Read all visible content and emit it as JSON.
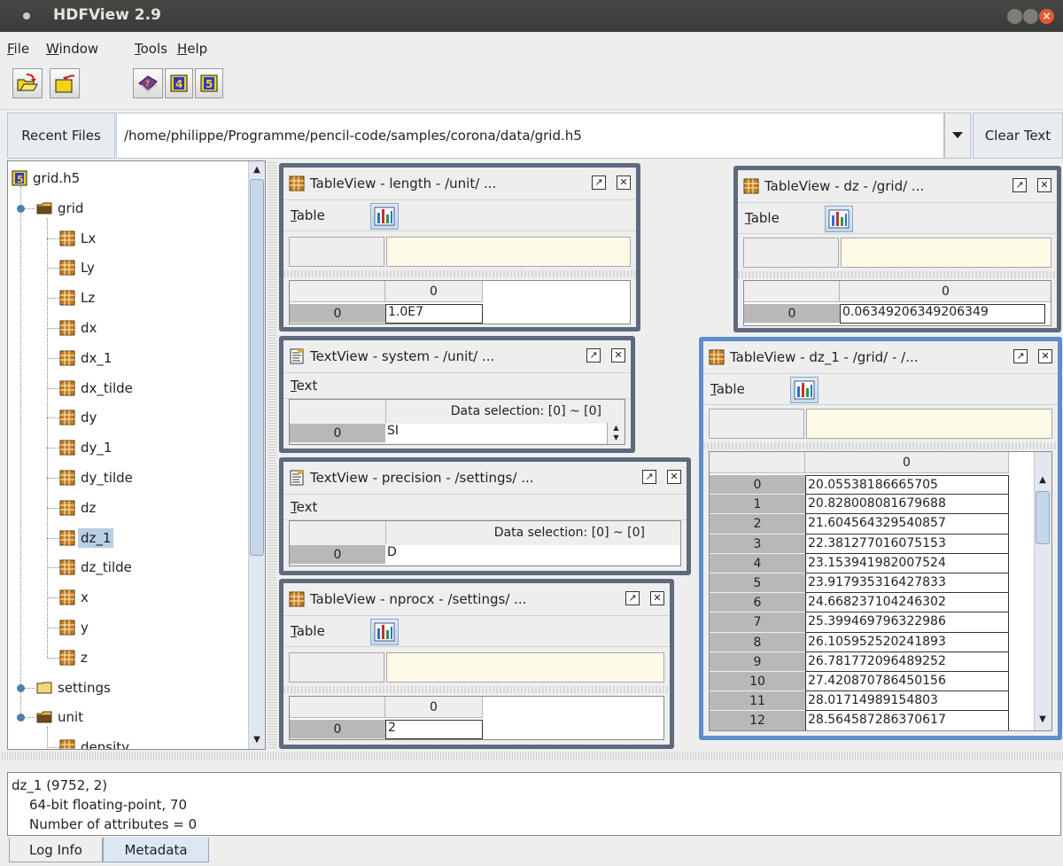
{
  "window": {
    "title": "HDFView 2.9"
  },
  "menu": [
    {
      "label": "File",
      "u": "F",
      "rest": "ile"
    },
    {
      "label": "Window",
      "u": "W",
      "rest": "indow"
    },
    {
      "label": "Tools",
      "u": "T",
      "rest": "ools"
    },
    {
      "label": "Help",
      "u": "H",
      "rest": "elp"
    }
  ],
  "toolbar": {
    "open_icon": "open-file-icon",
    "close_icon": "close-file-icon",
    "help_icon": "help-book-icon",
    "hdf4_icon": "hdf4-library-icon",
    "hdf5_icon": "hdf5-library-icon"
  },
  "recent": {
    "button_label": "Recent Files",
    "path": "/home/philippe/Programme/pencil-code/samples/corona/data/grid.h5",
    "clear_label": "Clear Text"
  },
  "tree": {
    "root": "grid.h5",
    "items": [
      {
        "label": "grid",
        "kind": "group-open",
        "level": 1
      },
      {
        "label": "Lx",
        "kind": "dataset",
        "level": 2
      },
      {
        "label": "Ly",
        "kind": "dataset",
        "level": 2
      },
      {
        "label": "Lz",
        "kind": "dataset",
        "level": 2
      },
      {
        "label": "dx",
        "kind": "dataset",
        "level": 2
      },
      {
        "label": "dx_1",
        "kind": "dataset",
        "level": 2
      },
      {
        "label": "dx_tilde",
        "kind": "dataset",
        "level": 2
      },
      {
        "label": "dy",
        "kind": "dataset",
        "level": 2
      },
      {
        "label": "dy_1",
        "kind": "dataset",
        "level": 2
      },
      {
        "label": "dy_tilde",
        "kind": "dataset",
        "level": 2
      },
      {
        "label": "dz",
        "kind": "dataset",
        "level": 2
      },
      {
        "label": "dz_1",
        "kind": "dataset",
        "level": 2,
        "selected": true
      },
      {
        "label": "dz_tilde",
        "kind": "dataset",
        "level": 2
      },
      {
        "label": "x",
        "kind": "dataset",
        "level": 2
      },
      {
        "label": "y",
        "kind": "dataset",
        "level": 2
      },
      {
        "label": "z",
        "kind": "dataset",
        "level": 2
      },
      {
        "label": "settings",
        "kind": "group-closed",
        "level": 1
      },
      {
        "label": "unit",
        "kind": "group-open",
        "level": 1
      },
      {
        "label": "density",
        "kind": "dataset",
        "level": 2
      }
    ]
  },
  "frames": {
    "length": {
      "title": "TableView  -  length  -  /unit/  ...",
      "menu": "Table",
      "menu_u": "T",
      "menu_rest": "able",
      "col_header": "0",
      "row_header": "0",
      "value": "1.0E7"
    },
    "system": {
      "title": "TextView  -  system  -  /unit/  ...",
      "menu": "Text",
      "menu_u": "T",
      "menu_rest": "ext",
      "selection": "Data selection:   [0] ~ [0]",
      "row_header": "0",
      "value": "SI"
    },
    "precision": {
      "title": "TextView  -  precision  -  /settings/  ...",
      "menu": "Text",
      "menu_u": "T",
      "menu_rest": "ext",
      "selection": "Data selection:   [0] ~ [0]",
      "row_header": "0",
      "value": "D"
    },
    "nprocx": {
      "title": "TableView  -  nprocx  -  /settings/ ...",
      "menu": "Table",
      "menu_u": "T",
      "menu_rest": "able",
      "col_header": "0",
      "row_header": "0",
      "value": "2"
    },
    "dz": {
      "title": "TableView  -  dz  -  /grid/  ...",
      "menu": "Table",
      "menu_u": "T",
      "menu_rest": "able",
      "col_header": "0",
      "row_header": "0",
      "value": "0.06349206349206349"
    },
    "dz_1": {
      "title": "TableView  -  dz_1  -  /grid/  - /...",
      "menu": "Table",
      "menu_u": "T",
      "menu_rest": "able",
      "col_header": "0",
      "rows": [
        {
          "index": "0",
          "value": "20.05538186665705"
        },
        {
          "index": "1",
          "value": "20.828008081679688"
        },
        {
          "index": "2",
          "value": "21.604564329540857"
        },
        {
          "index": "3",
          "value": "22.381277016075153"
        },
        {
          "index": "4",
          "value": "23.153941982007524"
        },
        {
          "index": "5",
          "value": "23.917935316427833"
        },
        {
          "index": "6",
          "value": "24.668237104246302"
        },
        {
          "index": "7",
          "value": "25.399469796322986"
        },
        {
          "index": "8",
          "value": "26.105952520241893"
        },
        {
          "index": "9",
          "value": "26.781772096489252"
        },
        {
          "index": "10",
          "value": "27.420870786450156"
        },
        {
          "index": "11",
          "value": "28.01714989154803"
        },
        {
          "index": "12",
          "value": "28.564587286370617"
        }
      ]
    }
  },
  "info": {
    "line1": "dz_1 (9752, 2)",
    "line2": "64-bit floating-point,    70",
    "line3": "Number of attributes = 0"
  },
  "bottom_tabs": [
    "Log Info",
    "Metadata"
  ],
  "colors": {
    "selection": "#b8cfe5",
    "active_frame": "#5f8dcc",
    "frame": "#5d6a7e",
    "address_bg": "#fdfbe8"
  }
}
